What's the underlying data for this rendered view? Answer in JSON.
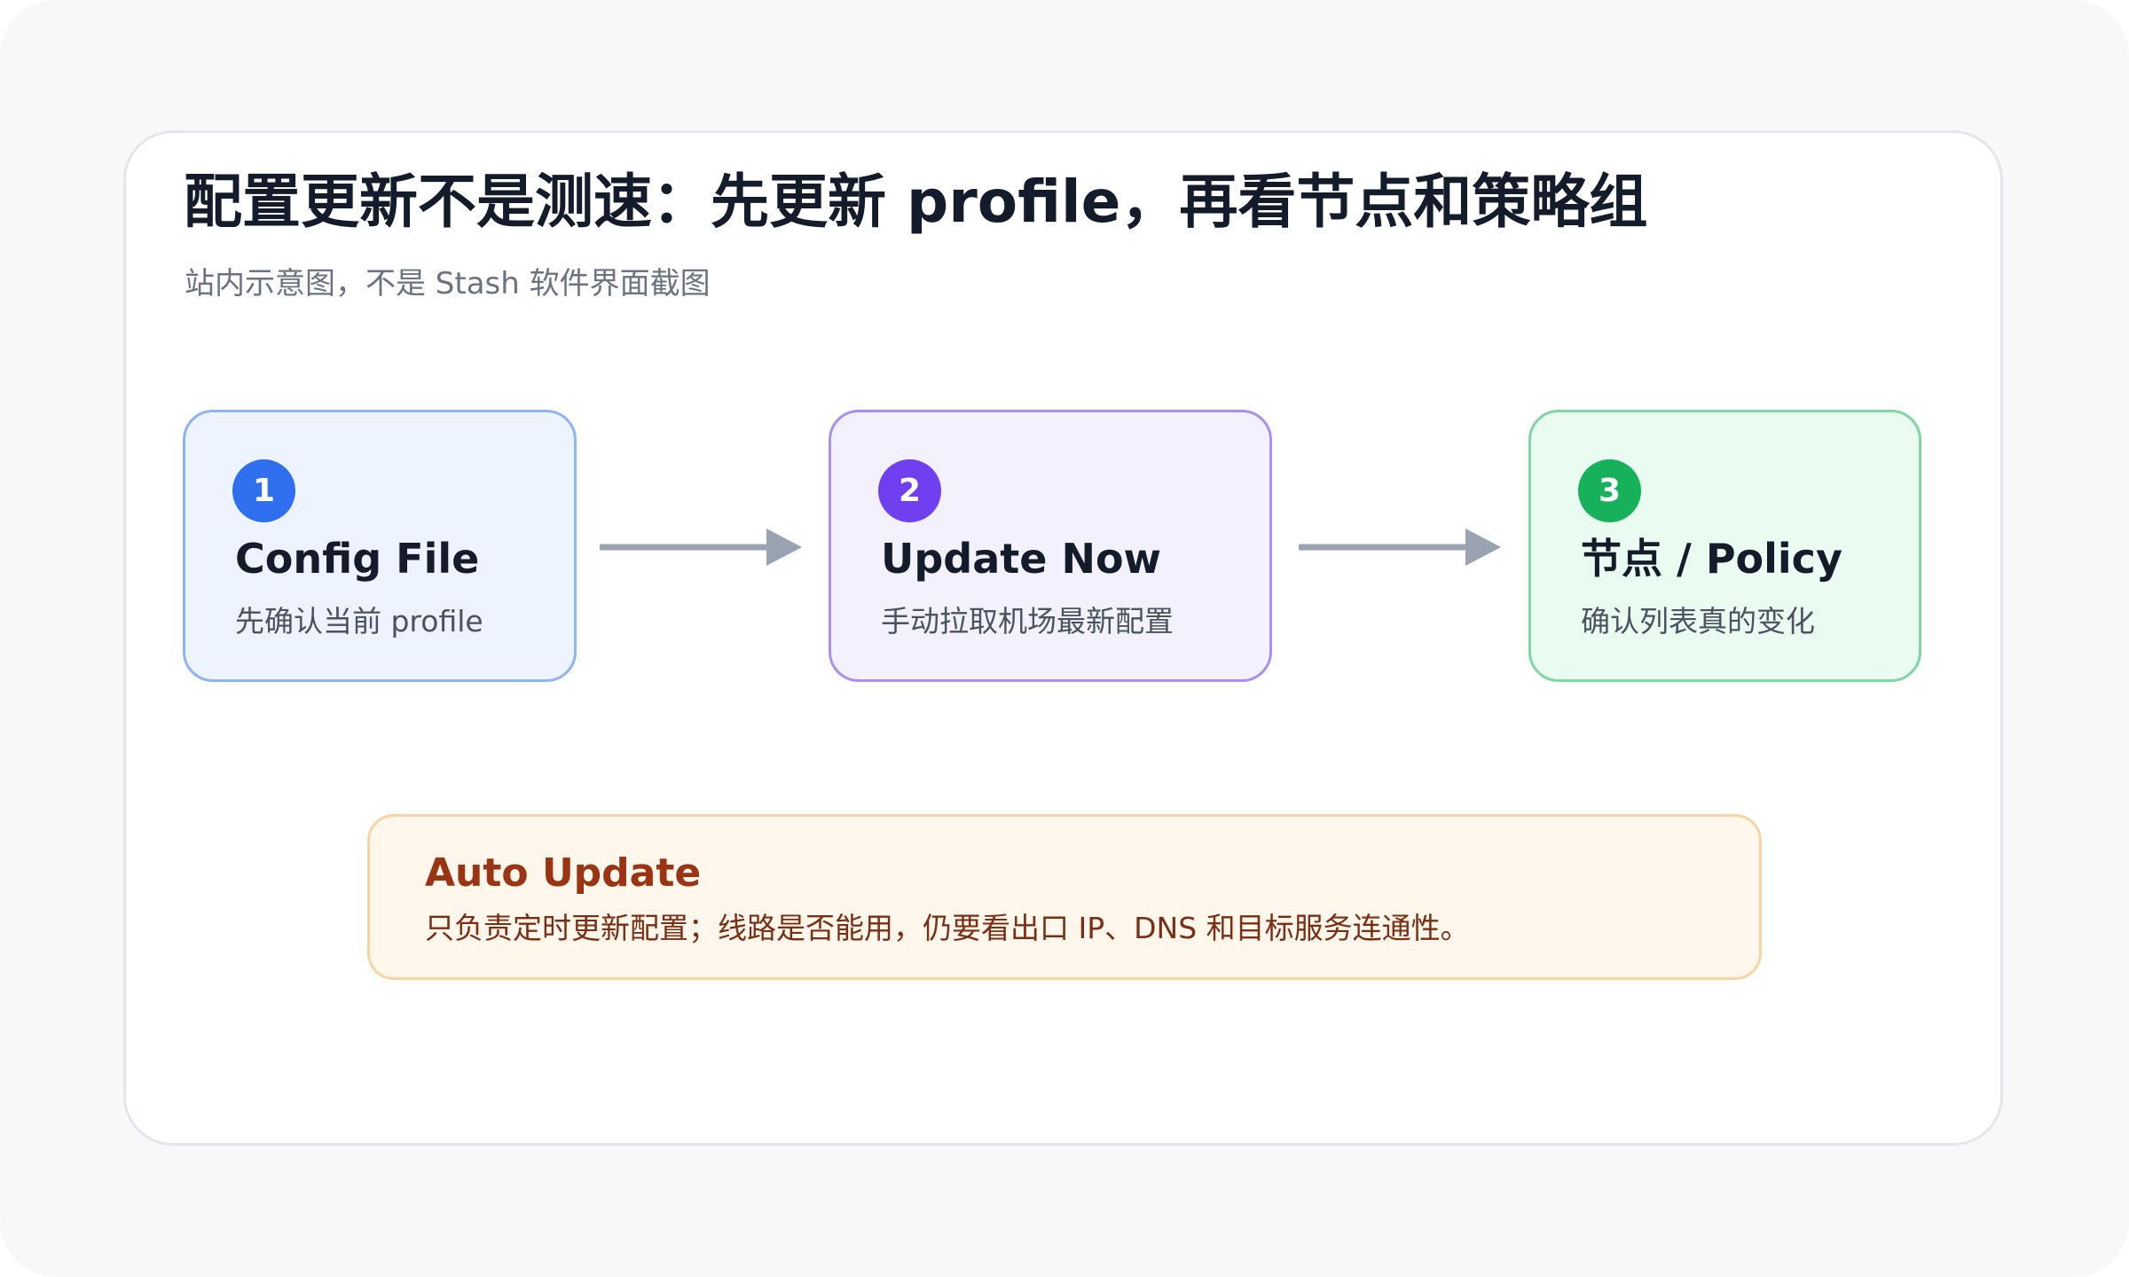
{
  "header": {
    "title": "配置更新不是测速：先更新 profile，再看节点和策略组",
    "subtitle": "站内示意图，不是 Stash 软件界面截图"
  },
  "steps": [
    {
      "number": "1",
      "title": "Config File",
      "description": "先确认当前 profile",
      "accent": "#2f6ff0"
    },
    {
      "number": "2",
      "title": "Update Now",
      "description": "手动拉取机场最新配置",
      "accent": "#7040f0"
    },
    {
      "number": "3",
      "title": "节点 / Policy",
      "description": "确认列表真的变化",
      "accent": "#17b05b"
    }
  ],
  "note": {
    "title": "Auto Update",
    "text": "只负责定时更新配置；线路是否能用，仍要看出口 IP、DNS 和目标服务连通性。"
  },
  "colors": {
    "arrow": "#9aa3b2",
    "note_accent": "#9a3412"
  }
}
